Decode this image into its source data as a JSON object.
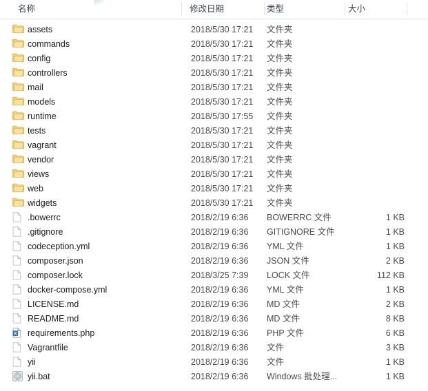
{
  "columns": {
    "name": "名称",
    "date_modified": "修改日期",
    "type": "类型",
    "size": "大小"
  },
  "rows": [
    {
      "icon": "folder-icon",
      "name": "assets",
      "date": "2018/5/30 17:21",
      "type": "文件夹",
      "size": ""
    },
    {
      "icon": "folder-icon",
      "name": "commands",
      "date": "2018/5/30 17:21",
      "type": "文件夹",
      "size": ""
    },
    {
      "icon": "folder-icon",
      "name": "config",
      "date": "2018/5/30 17:21",
      "type": "文件夹",
      "size": ""
    },
    {
      "icon": "folder-icon",
      "name": "controllers",
      "date": "2018/5/30 17:21",
      "type": "文件夹",
      "size": ""
    },
    {
      "icon": "folder-icon",
      "name": "mail",
      "date": "2018/5/30 17:21",
      "type": "文件夹",
      "size": ""
    },
    {
      "icon": "folder-icon",
      "name": "models",
      "date": "2018/5/30 17:21",
      "type": "文件夹",
      "size": ""
    },
    {
      "icon": "folder-icon",
      "name": "runtime",
      "date": "2018/5/30 17:55",
      "type": "文件夹",
      "size": ""
    },
    {
      "icon": "folder-icon",
      "name": "tests",
      "date": "2018/5/30 17:21",
      "type": "文件夹",
      "size": ""
    },
    {
      "icon": "folder-icon",
      "name": "vagrant",
      "date": "2018/5/30 17:21",
      "type": "文件夹",
      "size": ""
    },
    {
      "icon": "folder-icon",
      "name": "vendor",
      "date": "2018/5/30 17:21",
      "type": "文件夹",
      "size": ""
    },
    {
      "icon": "folder-icon",
      "name": "views",
      "date": "2018/5/30 17:21",
      "type": "文件夹",
      "size": ""
    },
    {
      "icon": "folder-icon",
      "name": "web",
      "date": "2018/5/30 17:21",
      "type": "文件夹",
      "size": ""
    },
    {
      "icon": "folder-icon",
      "name": "widgets",
      "date": "2018/5/30 17:21",
      "type": "文件夹",
      "size": ""
    },
    {
      "icon": "document-icon",
      "name": ".bowerrc",
      "date": "2018/2/19 6:36",
      "type": "BOWERRC 文件",
      "size": "1 KB"
    },
    {
      "icon": "document-icon",
      "name": ".gitignore",
      "date": "2018/2/19 6:36",
      "type": "GITIGNORE 文件",
      "size": "1 KB"
    },
    {
      "icon": "document-icon",
      "name": "codeception.yml",
      "date": "2018/2/19 6:36",
      "type": "YML 文件",
      "size": "1 KB"
    },
    {
      "icon": "document-icon",
      "name": "composer.json",
      "date": "2018/2/19 6:36",
      "type": "JSON 文件",
      "size": "2 KB"
    },
    {
      "icon": "document-icon",
      "name": "composer.lock",
      "date": "2018/3/25 7:39",
      "type": "LOCK 文件",
      "size": "112 KB"
    },
    {
      "icon": "document-icon",
      "name": "docker-compose.yml",
      "date": "2018/2/19 6:36",
      "type": "YML 文件",
      "size": "1 KB"
    },
    {
      "icon": "document-icon",
      "name": "LICENSE.md",
      "date": "2018/2/19 6:36",
      "type": "MD 文件",
      "size": "2 KB"
    },
    {
      "icon": "document-icon",
      "name": "README.md",
      "date": "2018/2/19 6:36",
      "type": "MD 文件",
      "size": "8 KB"
    },
    {
      "icon": "php-file-icon",
      "name": "requirements.php",
      "date": "2018/2/19 6:36",
      "type": "PHP 文件",
      "size": "6 KB"
    },
    {
      "icon": "document-icon",
      "name": "Vagrantfile",
      "date": "2018/2/19 6:36",
      "type": "文件",
      "size": "3 KB"
    },
    {
      "icon": "document-icon",
      "name": "yii",
      "date": "2018/2/19 6:36",
      "type": "文件",
      "size": "1 KB"
    },
    {
      "icon": "batch-file-icon",
      "name": "yii.bat",
      "date": "2018/2/19 6:36",
      "type": "Windows 批处理...",
      "size": "1 KB"
    }
  ],
  "colors": {
    "folder_icon": "#ecc96a",
    "folder_icon_dark": "#d8ae3f",
    "document_icon_border": "#b8bcc0",
    "php_icon_blue": "#2a6fb5",
    "batch_icon_gray": "#8f9aa3",
    "header_text": "#3b4650",
    "row_text": "#1c1c1c",
    "meta_text": "#4a4a4a",
    "separator": "#dfe3e8"
  }
}
